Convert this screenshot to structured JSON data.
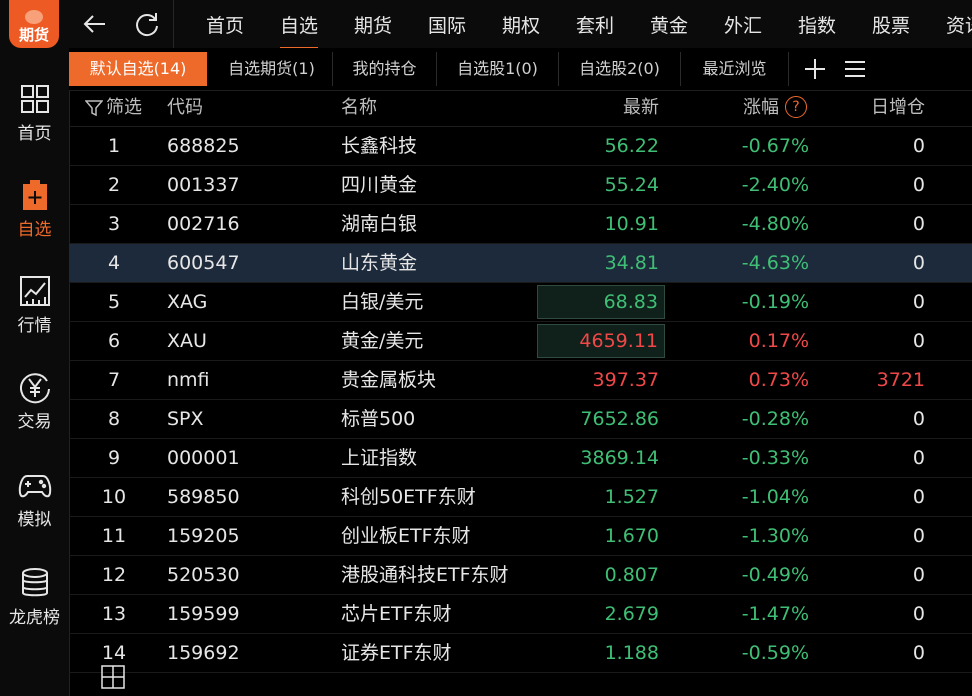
{
  "logo": {
    "text": "期货"
  },
  "sidebar": {
    "items": [
      {
        "label": "首页",
        "icon": "grid-icon"
      },
      {
        "label": "自选",
        "icon": "clipboard-plus-icon",
        "active": true
      },
      {
        "label": "行情",
        "icon": "chart-icon"
      },
      {
        "label": "交易",
        "icon": "yen-icon"
      },
      {
        "label": "模拟",
        "icon": "gamepad-icon"
      },
      {
        "label": "龙虎榜",
        "icon": "database-icon"
      }
    ]
  },
  "topnav": {
    "tabs": [
      "首页",
      "自选",
      "期货",
      "国际",
      "期权",
      "套利",
      "黄金",
      "外汇",
      "指数",
      "股票",
      "资讯"
    ],
    "active_index": 1
  },
  "subtabs": {
    "tabs": [
      "默认自选(14)",
      "自选期货(1)",
      "我的持仓",
      "自选股1(0)",
      "自选股2(0)",
      "最近浏览"
    ],
    "active_index": 0
  },
  "table": {
    "headers": {
      "filter": "筛选",
      "code": "代码",
      "name": "名称",
      "price": "最新",
      "change": "涨幅",
      "help": "?",
      "oi": "日增仓"
    },
    "rows": [
      {
        "idx": "1",
        "code": "688825",
        "name": "长鑫科技",
        "price": "56.22",
        "change": "-0.67%",
        "oi": "0",
        "trend": "down"
      },
      {
        "idx": "2",
        "code": "001337",
        "name": "四川黄金",
        "price": "55.24",
        "change": "-2.40%",
        "oi": "0",
        "trend": "down"
      },
      {
        "idx": "3",
        "code": "002716",
        "name": "湖南白银",
        "price": "10.91",
        "change": "-4.80%",
        "oi": "0",
        "trend": "down"
      },
      {
        "idx": "4",
        "code": "600547",
        "name": "山东黄金",
        "price": "34.81",
        "change": "-4.63%",
        "oi": "0",
        "trend": "down",
        "selected": true
      },
      {
        "idx": "5",
        "code": "XAG",
        "name": "白银/美元",
        "price": "68.83",
        "change": "-0.19%",
        "oi": "0",
        "trend": "down",
        "boxed": true
      },
      {
        "idx": "6",
        "code": "XAU",
        "name": "黄金/美元",
        "price": "4659.11",
        "change": "0.17%",
        "oi": "0",
        "trend": "up",
        "boxed": true
      },
      {
        "idx": "7",
        "code": "nmfi",
        "name": "贵金属板块",
        "price": "397.37",
        "change": "0.73%",
        "oi": "3721",
        "trend": "up"
      },
      {
        "idx": "8",
        "code": "SPX",
        "name": "标普500",
        "price": "7652.86",
        "change": "-0.28%",
        "oi": "0",
        "trend": "down"
      },
      {
        "idx": "9",
        "code": "000001",
        "name": "上证指数",
        "price": "3869.14",
        "change": "-0.33%",
        "oi": "0",
        "trend": "down"
      },
      {
        "idx": "10",
        "code": "589850",
        "name": "科创50ETF东财",
        "price": "1.527",
        "change": "-1.04%",
        "oi": "0",
        "trend": "down"
      },
      {
        "idx": "11",
        "code": "159205",
        "name": "创业板ETF东财",
        "price": "1.670",
        "change": "-1.30%",
        "oi": "0",
        "trend": "down"
      },
      {
        "idx": "12",
        "code": "520530",
        "name": "港股通科技ETF东财",
        "price": "0.807",
        "change": "-0.49%",
        "oi": "0",
        "trend": "down"
      },
      {
        "idx": "13",
        "code": "159599",
        "name": "芯片ETF东财",
        "price": "2.679",
        "change": "-1.47%",
        "oi": "0",
        "trend": "down"
      },
      {
        "idx": "14",
        "code": "159692",
        "name": "证券ETF东财",
        "price": "1.188",
        "change": "-0.59%",
        "oi": "0",
        "trend": "down"
      }
    ]
  },
  "colors": {
    "accent": "#ee6a2a",
    "up": "#f04848",
    "down": "#3fbf75",
    "selected_row": "#1c2a3c"
  }
}
